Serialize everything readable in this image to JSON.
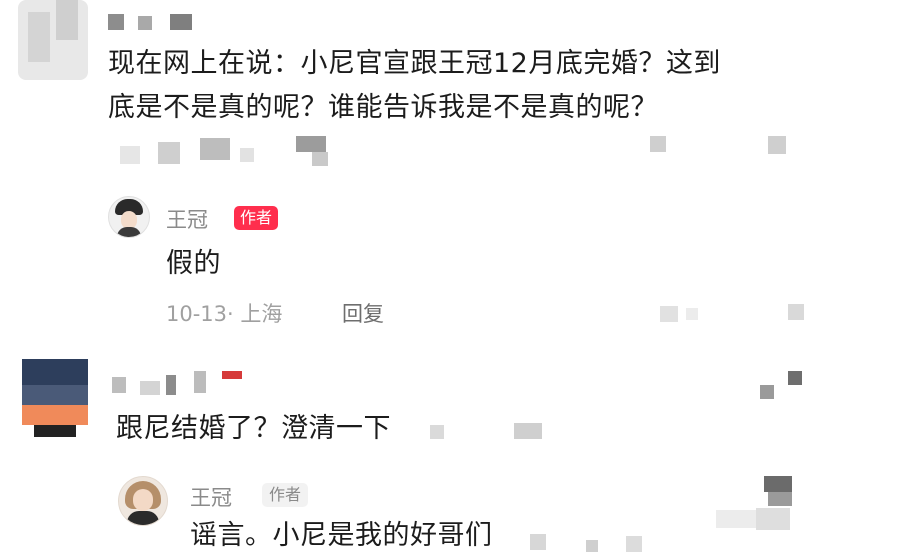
{
  "comments": [
    {
      "text_line1": "现在网上在说：小尼官宣跟王冠12月底完婚？这到",
      "text_line2": "底是不是真的呢？谁能告诉我是不是真的呢？"
    },
    {
      "text": "跟尼结婚了？澄清一下"
    }
  ],
  "replies": [
    {
      "author": "王冠",
      "badge": "作者",
      "text": "假的",
      "meta_date_location": "10-13· 上海",
      "reply_label": "回复"
    },
    {
      "author": "王冠",
      "badge": "作者",
      "text": "谣言。小尼是我的好哥们"
    }
  ],
  "colors": {
    "author_badge_bg": "#ff2e4d",
    "author_badge_text": "#ffffff",
    "muted_text": "#8a8a8a"
  }
}
